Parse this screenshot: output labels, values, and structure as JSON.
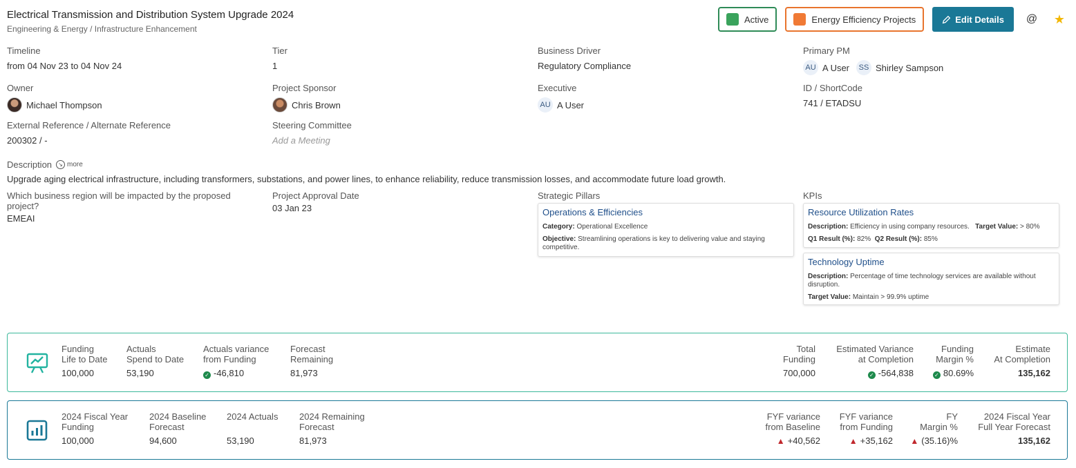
{
  "header": {
    "title": "Electrical Transmission and Distribution System Upgrade 2024",
    "subtitle": "Engineering & Energy / Infrastructure Enhancement",
    "status_tag": "Active",
    "category_tag": "Energy Efficiency Projects",
    "edit_label": "Edit Details",
    "at_symbol": "@",
    "star_symbol": "★",
    "colors": {
      "active": "#3aa35c",
      "energy": "#f07a35",
      "edit": "#1a7896"
    }
  },
  "fields": {
    "timeline": {
      "label": "Timeline",
      "value": "from 04 Nov 23 to 04 Nov 24"
    },
    "tier": {
      "label": "Tier",
      "value": "1"
    },
    "business_driver": {
      "label": "Business Driver",
      "value": "Regulatory Compliance"
    },
    "primary_pm": {
      "label": "Primary PM",
      "people": [
        {
          "initials": "AU",
          "name": "A User"
        },
        {
          "initials": "SS",
          "name": "Shirley Sampson"
        }
      ]
    },
    "owner": {
      "label": "Owner",
      "name": "Michael Thompson"
    },
    "sponsor": {
      "label": "Project Sponsor",
      "name": "Chris Brown"
    },
    "executive": {
      "label": "Executive",
      "initials": "AU",
      "name": "A User"
    },
    "id_shortcode": {
      "label": "ID / ShortCode",
      "value": "741 / ETADSU"
    },
    "external_ref": {
      "label": "External Reference / Alternate Reference",
      "value": "200302 / -"
    },
    "steering": {
      "label": "Steering Committee",
      "value": "Add a Meeting"
    },
    "region": {
      "label": "Which business region will be impacted by the proposed project?",
      "value": "EMEAI"
    },
    "approval": {
      "label": "Project Approval Date",
      "value": "03 Jan 23"
    },
    "pillars_label": "Strategic Pillars",
    "kpis_label": "KPIs"
  },
  "description": {
    "label": "Description",
    "more": "more",
    "text": "Upgrade aging electrical infrastructure, including transformers, substations, and power lines, to enhance reliability, reduce transmission losses, and accommodate future load growth."
  },
  "pillar": {
    "title": "Operations & Efficiencies",
    "category_key": "Category:",
    "category": "Operational Excellence",
    "objective_key": "Objective:",
    "objective": "Streamlining operations is key to delivering value and staying competitive."
  },
  "kpis": [
    {
      "title": "Resource Utilization Rates",
      "desc_key": "Description:",
      "desc": "Efficiency in using company resources.",
      "target_key": "Target Value:",
      "target": "> 80%",
      "q1_key": "Q1 Result (%):",
      "q1": "82%",
      "q2_key": "Q2 Result (%):",
      "q2": "85%"
    },
    {
      "title": "Technology Uptime",
      "desc_key": "Description:",
      "desc": "Percentage of time technology services are available without disruption.",
      "target_key": "Target Value:",
      "target": "Maintain > 99.9% uptime"
    }
  ],
  "panel1": {
    "left": [
      {
        "l1": "Funding",
        "l2": "Life to Date",
        "value": "100,000"
      },
      {
        "l1": "Actuals",
        "l2": "Spend to Date",
        "value": "53,190"
      },
      {
        "l1": "Actuals variance",
        "l2": "from Funding",
        "value": "-46,810"
      },
      {
        "l1": "Forecast",
        "l2": "Remaining",
        "value": "81,973"
      }
    ],
    "right": [
      {
        "l1": "Total",
        "l2": "Funding",
        "value": "700,000"
      },
      {
        "l1": "Estimated Variance",
        "l2": "at Completion",
        "value": "-564,838"
      },
      {
        "l1": "Funding",
        "l2": "Margin %",
        "value": "80.69%"
      },
      {
        "l1": "Estimate",
        "l2": "At Completion",
        "value": "135,162"
      }
    ]
  },
  "panel2": {
    "left": [
      {
        "l1": "2024 Fiscal Year",
        "l2": "Funding",
        "value": "100,000"
      },
      {
        "l1": "2024 Baseline",
        "l2": "Forecast",
        "value": "94,600"
      },
      {
        "l1": "2024 Actuals",
        "l2": "",
        "value": "53,190"
      },
      {
        "l1": "2024 Remaining",
        "l2": "Forecast",
        "value": "81,973"
      }
    ],
    "right": [
      {
        "l1": "FYF variance",
        "l2": "from Baseline",
        "value": "+40,562"
      },
      {
        "l1": "FYF variance",
        "l2": "from Funding",
        "value": "+35,162"
      },
      {
        "l1": "FY",
        "l2": "Margin %",
        "value": "(35.16)%"
      },
      {
        "l1": "2024 Fiscal Year",
        "l2": "Full Year Forecast",
        "value": "135,162"
      }
    ]
  }
}
